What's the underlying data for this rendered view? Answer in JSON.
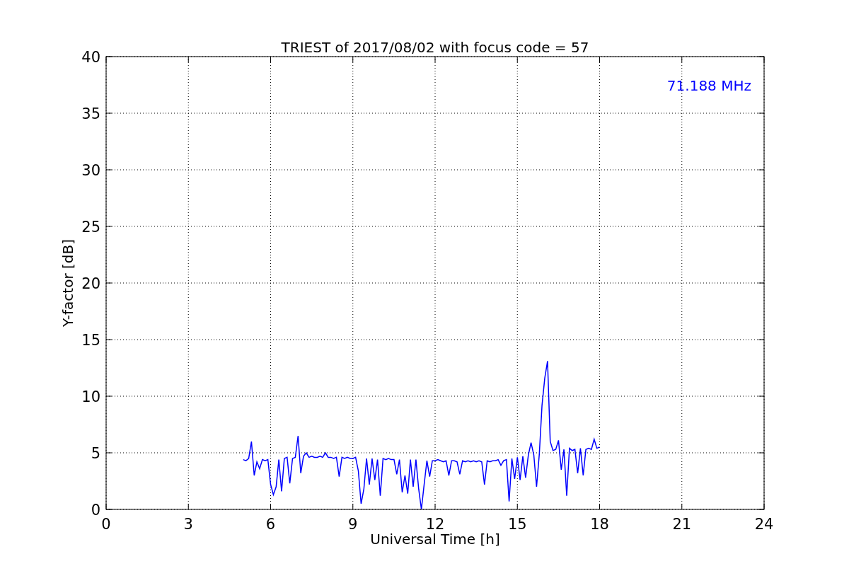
{
  "chart": {
    "chart_data": {
      "type": "line",
      "title": "TRIEST of 2017/08/02 with focus code = 57",
      "xlabel": "Universal Time [h]",
      "ylabel": "Y-factor [dB]",
      "x": [
        5.0,
        5.1,
        5.2,
        5.3,
        5.4,
        5.5,
        5.6,
        5.7,
        5.8,
        5.9,
        6.0,
        6.1,
        6.2,
        6.3,
        6.4,
        6.5,
        6.6,
        6.7,
        6.8,
        6.9,
        7.0,
        7.1,
        7.2,
        7.3,
        7.4,
        7.5,
        7.6,
        7.7,
        7.8,
        7.9,
        8.0,
        8.1,
        8.2,
        8.3,
        8.4,
        8.5,
        8.6,
        8.7,
        8.8,
        8.9,
        9.0,
        9.1,
        9.2,
        9.3,
        9.4,
        9.5,
        9.6,
        9.7,
        9.8,
        9.9,
        10.0,
        10.1,
        10.2,
        10.3,
        10.4,
        10.5,
        10.6,
        10.7,
        10.8,
        10.9,
        11.0,
        11.1,
        11.2,
        11.3,
        11.4,
        11.5,
        11.6,
        11.7,
        11.8,
        11.9,
        12.0,
        12.1,
        12.2,
        12.3,
        12.4,
        12.5,
        12.6,
        12.7,
        12.8,
        12.9,
        13.0,
        13.1,
        13.2,
        13.3,
        13.4,
        13.5,
        13.6,
        13.7,
        13.8,
        13.9,
        14.0,
        14.1,
        14.2,
        14.3,
        14.4,
        14.5,
        14.6,
        14.7,
        14.8,
        14.9,
        15.0,
        15.1,
        15.2,
        15.3,
        15.4,
        15.5,
        15.6,
        15.7,
        15.8,
        15.9,
        16.0,
        16.1,
        16.2,
        16.3,
        16.4,
        16.5,
        16.6,
        16.7,
        16.8,
        16.9,
        17.0,
        17.1,
        17.2,
        17.3,
        17.4,
        17.5,
        17.6,
        17.7,
        17.8,
        17.9,
        18.0
      ],
      "series": [
        {
          "name": "71.188 MHz",
          "color": "#0000ff",
          "values": [
            4.4,
            4.3,
            4.5,
            6.0,
            3.0,
            4.2,
            3.6,
            4.4,
            4.3,
            4.4,
            2.2,
            1.3,
            2.0,
            4.4,
            1.6,
            4.5,
            4.6,
            2.3,
            4.5,
            4.6,
            6.5,
            3.2,
            4.7,
            5.0,
            4.6,
            4.7,
            4.6,
            4.6,
            4.7,
            4.6,
            5.0,
            4.6,
            4.6,
            4.5,
            4.6,
            2.9,
            4.6,
            4.5,
            4.6,
            4.5,
            4.5,
            4.6,
            3.4,
            0.5,
            1.8,
            4.5,
            2.2,
            4.5,
            2.6,
            4.4,
            1.2,
            4.5,
            4.4,
            4.5,
            4.4,
            4.4,
            3.1,
            4.4,
            1.5,
            3.0,
            1.4,
            4.4,
            2.0,
            4.4,
            1.8,
            0.0,
            2.2,
            4.3,
            2.9,
            4.3,
            4.3,
            4.4,
            4.3,
            4.2,
            4.3,
            3.0,
            4.3,
            4.3,
            4.2,
            3.1,
            4.3,
            4.2,
            4.3,
            4.2,
            4.3,
            4.2,
            4.3,
            4.2,
            2.2,
            4.3,
            4.2,
            4.3,
            4.3,
            4.4,
            3.9,
            4.3,
            4.4,
            0.7,
            4.5,
            2.7,
            4.6,
            2.6,
            4.7,
            2.8,
            4.8,
            5.9,
            4.8,
            2.0,
            4.9,
            9.2,
            11.6,
            13.1,
            6.0,
            5.2,
            5.3,
            6.1,
            3.5,
            5.3,
            1.2,
            5.4,
            5.2,
            5.3,
            3.2,
            5.4,
            3.0,
            5.3,
            5.4,
            5.3,
            6.2,
            5.4,
            5.5
          ]
        }
      ],
      "xlim": [
        0,
        24
      ],
      "ylim": [
        0,
        40
      ],
      "xticks": [
        0,
        3,
        6,
        9,
        12,
        15,
        18,
        21,
        24
      ],
      "yticks": [
        0,
        5,
        10,
        15,
        20,
        25,
        30,
        35,
        40
      ],
      "grid": true
    }
  }
}
